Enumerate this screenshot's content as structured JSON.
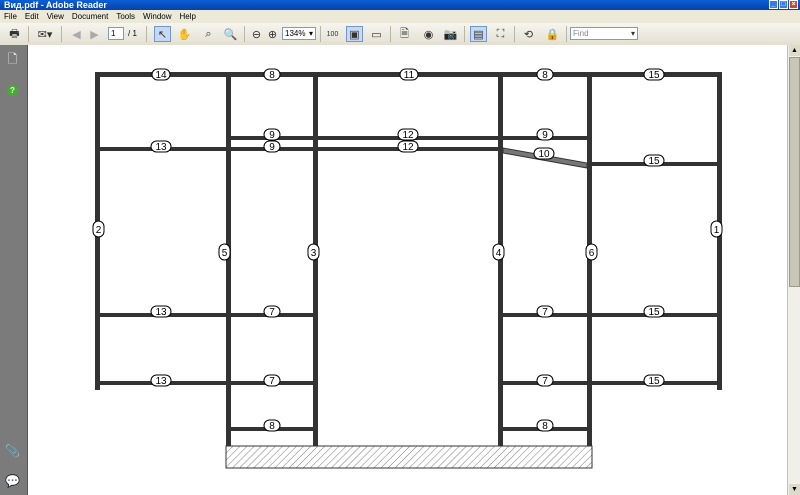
{
  "window": {
    "title": "Вид.pdf - Adobe Reader"
  },
  "menu": [
    "File",
    "Edit",
    "View",
    "Document",
    "Tools",
    "Window",
    "Help"
  ],
  "toolbar": {
    "page_current": "1",
    "page_total_label": "/ 1",
    "zoom": "134%",
    "find_placeholder": "Find"
  },
  "drawing": {
    "labels": {
      "top_left_shelf": "14",
      "top_second_shelf": "8",
      "top_center_shelf": "11",
      "top_fourth_shelf": "8",
      "top_right_shelf": "15",
      "upper_second_shelf_a": "9",
      "upper_second_shelf_b": "9",
      "upper_center_shelf_a": "12",
      "upper_center_shelf_b": "12",
      "upper_fourth_shelf": "9",
      "upper_left_shelf": "13",
      "slanted_shelf": "10",
      "upper_right_shelf": "15",
      "left_outer_post": "2",
      "post_5": "5",
      "post_3": "3",
      "post_4": "4",
      "post_6": "6",
      "right_outer_post": "1",
      "mid_left_shelf": "13",
      "mid_second_shelf": "7",
      "mid_fourth_shelf": "7",
      "mid_right_shelf": "15",
      "low_left_shelf": "13",
      "low_second_shelf": "7",
      "low_fourth_shelf": "7",
      "low_right_shelf": "15",
      "bottom_second_shelf": "8",
      "bottom_fourth_shelf": "8"
    }
  }
}
